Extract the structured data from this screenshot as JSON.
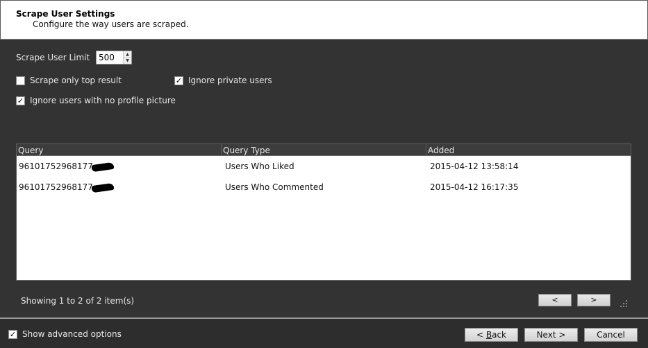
{
  "header": {
    "title": "Scrape User Settings",
    "subtitle": "Configure the way users are scraped."
  },
  "settings": {
    "limit_label": "Scrape User Limit",
    "limit_value": "500",
    "top_result": {
      "label": "Scrape only top result",
      "checked": false
    },
    "ignore_private": {
      "label": "Ignore private users",
      "checked": true
    },
    "ignore_no_picture": {
      "label": "Ignore users with no profile picture",
      "checked": true
    }
  },
  "grid": {
    "columns": [
      "Query",
      "Query Type",
      "Added"
    ],
    "rows": [
      {
        "query": "96101752968177",
        "type": "Users Who Liked",
        "added": "2015-04-12 13:58:14"
      },
      {
        "query": "96101752968177",
        "type": "Users Who Commented",
        "added": "2015-04-12 16:17:35"
      }
    ]
  },
  "pager": {
    "text": "Showing 1 to 2 of 2 item(s)",
    "prev": "<",
    "next": ">"
  },
  "footer": {
    "advanced": {
      "label": "Show advanced options",
      "checked": true
    },
    "back_prefix": "< ",
    "back_key": "B",
    "back_rest": "ack",
    "next": "Next >",
    "cancel": "Cancel"
  }
}
